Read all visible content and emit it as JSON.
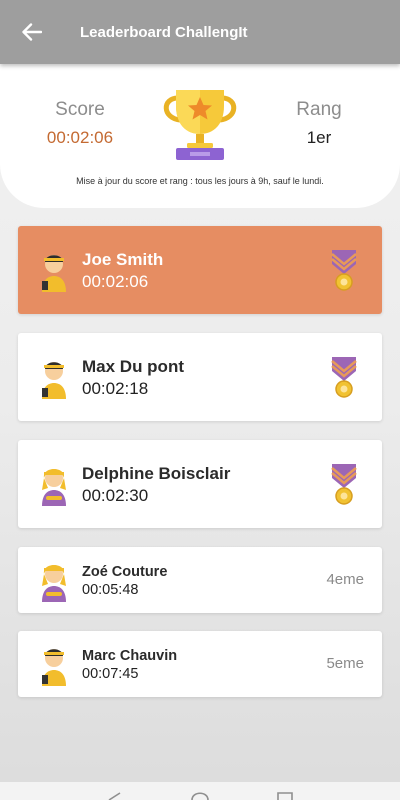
{
  "appbar": {
    "title": "Leaderboard ChallengIt",
    "back_icon": "arrow-left-icon"
  },
  "score": {
    "score_label": "Score",
    "score_value": "00:02:06",
    "rank_label": "Rang",
    "rank_value": "1er",
    "trophy_icon": "trophy-icon",
    "update_note": "Mise à jour du score et rang : tous les jours à 9h, sauf le lundi."
  },
  "leaderboard": [
    {
      "name": "Joe Smith",
      "time": "00:02:06",
      "rank": "",
      "medal": "gold-medal-icon",
      "highlighted": true
    },
    {
      "name": "Max Du pont",
      "time": "00:02:18",
      "rank": "",
      "medal": "silver-medal-icon",
      "highlighted": false
    },
    {
      "name": "Delphine Boisclair",
      "time": "00:02:30",
      "rank": "",
      "medal": "bronze-medal-icon",
      "highlighted": false
    },
    {
      "name": "Zoé Couture",
      "time": "00:05:48",
      "rank": "4eme",
      "highlighted": false
    },
    {
      "name": "Marc Chauvin",
      "time": "00:07:45",
      "rank": "5eme",
      "highlighted": false
    }
  ],
  "colors": {
    "appbar": "#9e9e9e",
    "highlight": "#e68d62",
    "score_value": "#c46a32",
    "medal_ribbon": "#9c66b5",
    "medal_gold": "#f1c232"
  }
}
